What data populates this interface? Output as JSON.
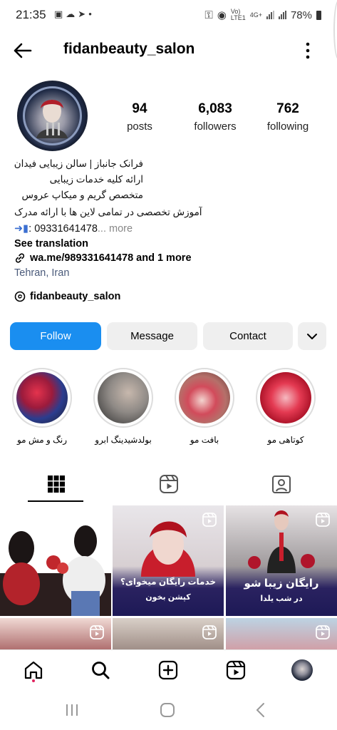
{
  "status_bar": {
    "time": "21:35",
    "left_icons": [
      "image-icon",
      "cloud-icon",
      "telegram-icon",
      "dot-icon"
    ],
    "right_small_1": "Vo)",
    "right_small_2": "LTE1",
    "network": "4G+",
    "battery": "78%"
  },
  "header": {
    "username": "fidanbeauty_salon",
    "back_icon": "arrow-left-icon",
    "more_icon": "vertical-dots-icon"
  },
  "stats": {
    "posts": {
      "value": "94",
      "label": "posts"
    },
    "followers": {
      "value": "6,083",
      "label": "followers"
    },
    "following": {
      "value": "762",
      "label": "following"
    }
  },
  "bio": {
    "line1": "فرانک جانباز | سالن زیبایی فیدان",
    "line2": "ارائه کلیه خدمات زیبایی",
    "line3": "متخصص گریم و میکاپ عروس",
    "line4": "آموزش تخصصی در تمامی لاین ها با ارائه مدرک",
    "phone": ": 09331641478",
    "more": "... more",
    "see_translation": "See translation",
    "link": "wa.me/989331641478 and 1 more",
    "location": "Tehran, Iran",
    "threads_handle": "fidanbeauty_salon"
  },
  "buttons": {
    "follow": "Follow",
    "message": "Message",
    "contact": "Contact"
  },
  "highlights": [
    {
      "label": "کوتاهی مو",
      "color": "#c0392b"
    },
    {
      "label": "بافت مو",
      "color": "#b5706a"
    },
    {
      "label": "بولدشیدینگ ابرو",
      "color": "#8f8a86"
    },
    {
      "label": "رنگ و مش مو",
      "color": "#2b3d8f"
    }
  ],
  "tabs": [
    "grid-icon",
    "reels-icon",
    "tagged-icon"
  ],
  "posts": {
    "post2_caption_1": "خدمات رایگان میخوای؟",
    "post2_caption_2": "کپشن بخون",
    "post3_caption_1": "رایگان زیبا شو",
    "post3_caption_2": "در شب یلدا"
  },
  "bottom_nav": [
    "home-icon",
    "search-icon",
    "create-icon",
    "reels-icon",
    "profile-avatar"
  ],
  "colors": {
    "follow_blue": "#1a8ef0",
    "secondary_button": "#efefef",
    "location_text": "#4a5a7a",
    "notification_dot": "#e0245e"
  }
}
